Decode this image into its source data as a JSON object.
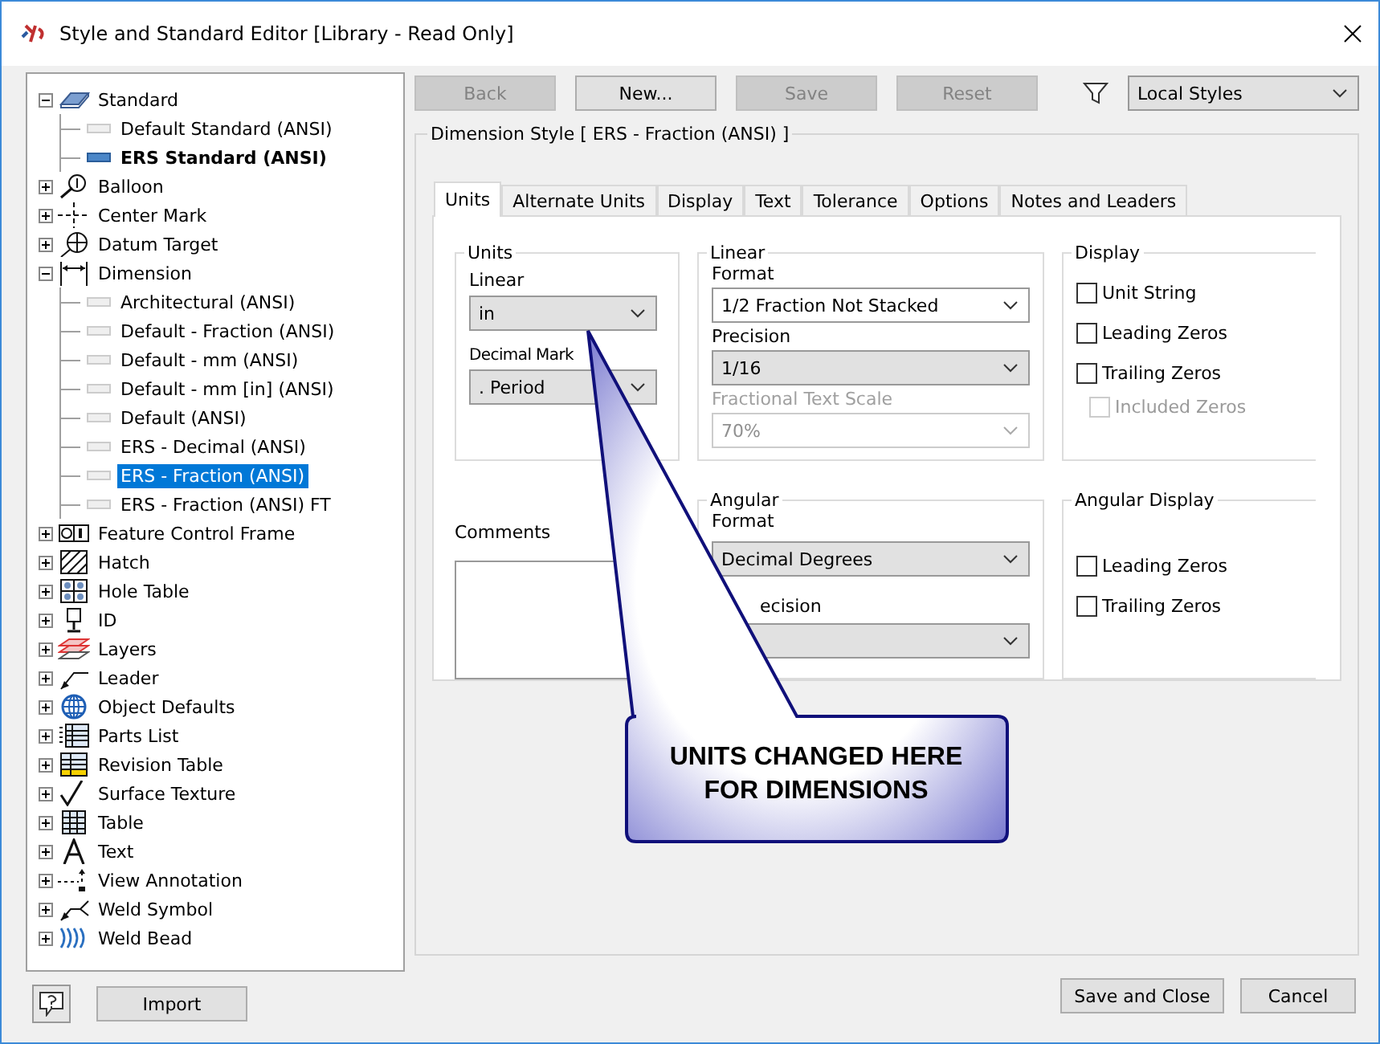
{
  "window": {
    "title": "Style and Standard Editor [Library - Read Only]"
  },
  "tree": [
    {
      "label": "Standard",
      "expanded": true,
      "children": [
        {
          "label": "Default Standard (ANSI)",
          "active": false,
          "selected": false
        },
        {
          "label": "ERS Standard (ANSI)",
          "active": true,
          "selected": false
        }
      ]
    },
    {
      "label": "Balloon",
      "expanded": false
    },
    {
      "label": "Center Mark",
      "expanded": false
    },
    {
      "label": "Datum Target",
      "expanded": false
    },
    {
      "label": "Dimension",
      "expanded": true,
      "children": [
        {
          "label": "Architectural (ANSI)",
          "active": false,
          "selected": false
        },
        {
          "label": "Default - Fraction (ANSI)",
          "active": false,
          "selected": false
        },
        {
          "label": "Default - mm (ANSI)",
          "active": false,
          "selected": false
        },
        {
          "label": "Default - mm [in] (ANSI)",
          "active": false,
          "selected": false
        },
        {
          "label": "Default (ANSI)",
          "active": false,
          "selected": false
        },
        {
          "label": "ERS - Decimal (ANSI)",
          "active": false,
          "selected": false
        },
        {
          "label": "ERS - Fraction (ANSI)",
          "active": false,
          "selected": true
        },
        {
          "label": "ERS - Fraction (ANSI) FT",
          "active": false,
          "selected": false
        }
      ]
    },
    {
      "label": "Feature Control Frame",
      "expanded": false
    },
    {
      "label": "Hatch",
      "expanded": false
    },
    {
      "label": "Hole Table",
      "expanded": false
    },
    {
      "label": "ID",
      "expanded": false
    },
    {
      "label": "Layers",
      "expanded": false
    },
    {
      "label": "Leader",
      "expanded": false
    },
    {
      "label": "Object Defaults",
      "expanded": false
    },
    {
      "label": "Parts List",
      "expanded": false
    },
    {
      "label": "Revision Table",
      "expanded": false
    },
    {
      "label": "Surface Texture",
      "expanded": false
    },
    {
      "label": "Table",
      "expanded": false
    },
    {
      "label": "Text",
      "expanded": false
    },
    {
      "label": "View Annotation",
      "expanded": false
    },
    {
      "label": "Weld Symbol",
      "expanded": false
    },
    {
      "label": "Weld Bead",
      "expanded": false
    }
  ],
  "toolbar": {
    "buttons": [
      {
        "label": "Back",
        "disabled": true
      },
      {
        "label": "New...",
        "disabled": false
      },
      {
        "label": "Save",
        "disabled": true
      },
      {
        "label": "Reset",
        "disabled": true
      }
    ],
    "filter": "Local Styles"
  },
  "style_title": "Dimension Style [ ERS - Fraction (ANSI) ]",
  "tabs": [
    {
      "label": "Units",
      "selected": true
    },
    {
      "label": "Alternate Units",
      "selected": false
    },
    {
      "label": "Display",
      "selected": false
    },
    {
      "label": "Text",
      "selected": false
    },
    {
      "label": "Tolerance",
      "selected": false
    },
    {
      "label": "Options",
      "selected": false
    },
    {
      "label": "Notes and Leaders",
      "selected": false
    }
  ],
  "units": {
    "title": "Units",
    "linear_label": "Linear",
    "linear": "in",
    "decimal_marker_label": "Decimal Mark",
    "decimal_marker": ". Period"
  },
  "linear": {
    "title": "Linear",
    "format_label": "Format",
    "format": "1/2 Fraction Not Stacked",
    "precision_label": "Precision",
    "precision": "1/16",
    "scale_label": "Fractional Text Scale",
    "scale": "70%"
  },
  "display": {
    "title": "Display",
    "options": [
      {
        "label": "Unit String",
        "checked": false,
        "disabled": false
      },
      {
        "label": "Leading Zeros",
        "checked": false,
        "disabled": false
      },
      {
        "label": "Trailing Zeros",
        "checked": false,
        "disabled": false
      },
      {
        "label": "Included Zeros",
        "checked": false,
        "disabled": true
      }
    ]
  },
  "comments": {
    "label": "Comments"
  },
  "angular": {
    "title": "Angular",
    "format_label": "Format",
    "format": "Decimal Degrees",
    "precision_label": "ecision"
  },
  "angular_display": {
    "title": "Angular Display",
    "options": [
      {
        "label": "Leading Zeros",
        "checked": false,
        "disabled": false
      },
      {
        "label": "Trailing Zeros",
        "checked": false,
        "disabled": false
      }
    ]
  },
  "callout": {
    "text": "UNITS CHANGED HERE FOR DIMENSIONS"
  },
  "footer": {
    "import": "Import",
    "save_close": "Save and Close",
    "cancel": "Cancel"
  }
}
